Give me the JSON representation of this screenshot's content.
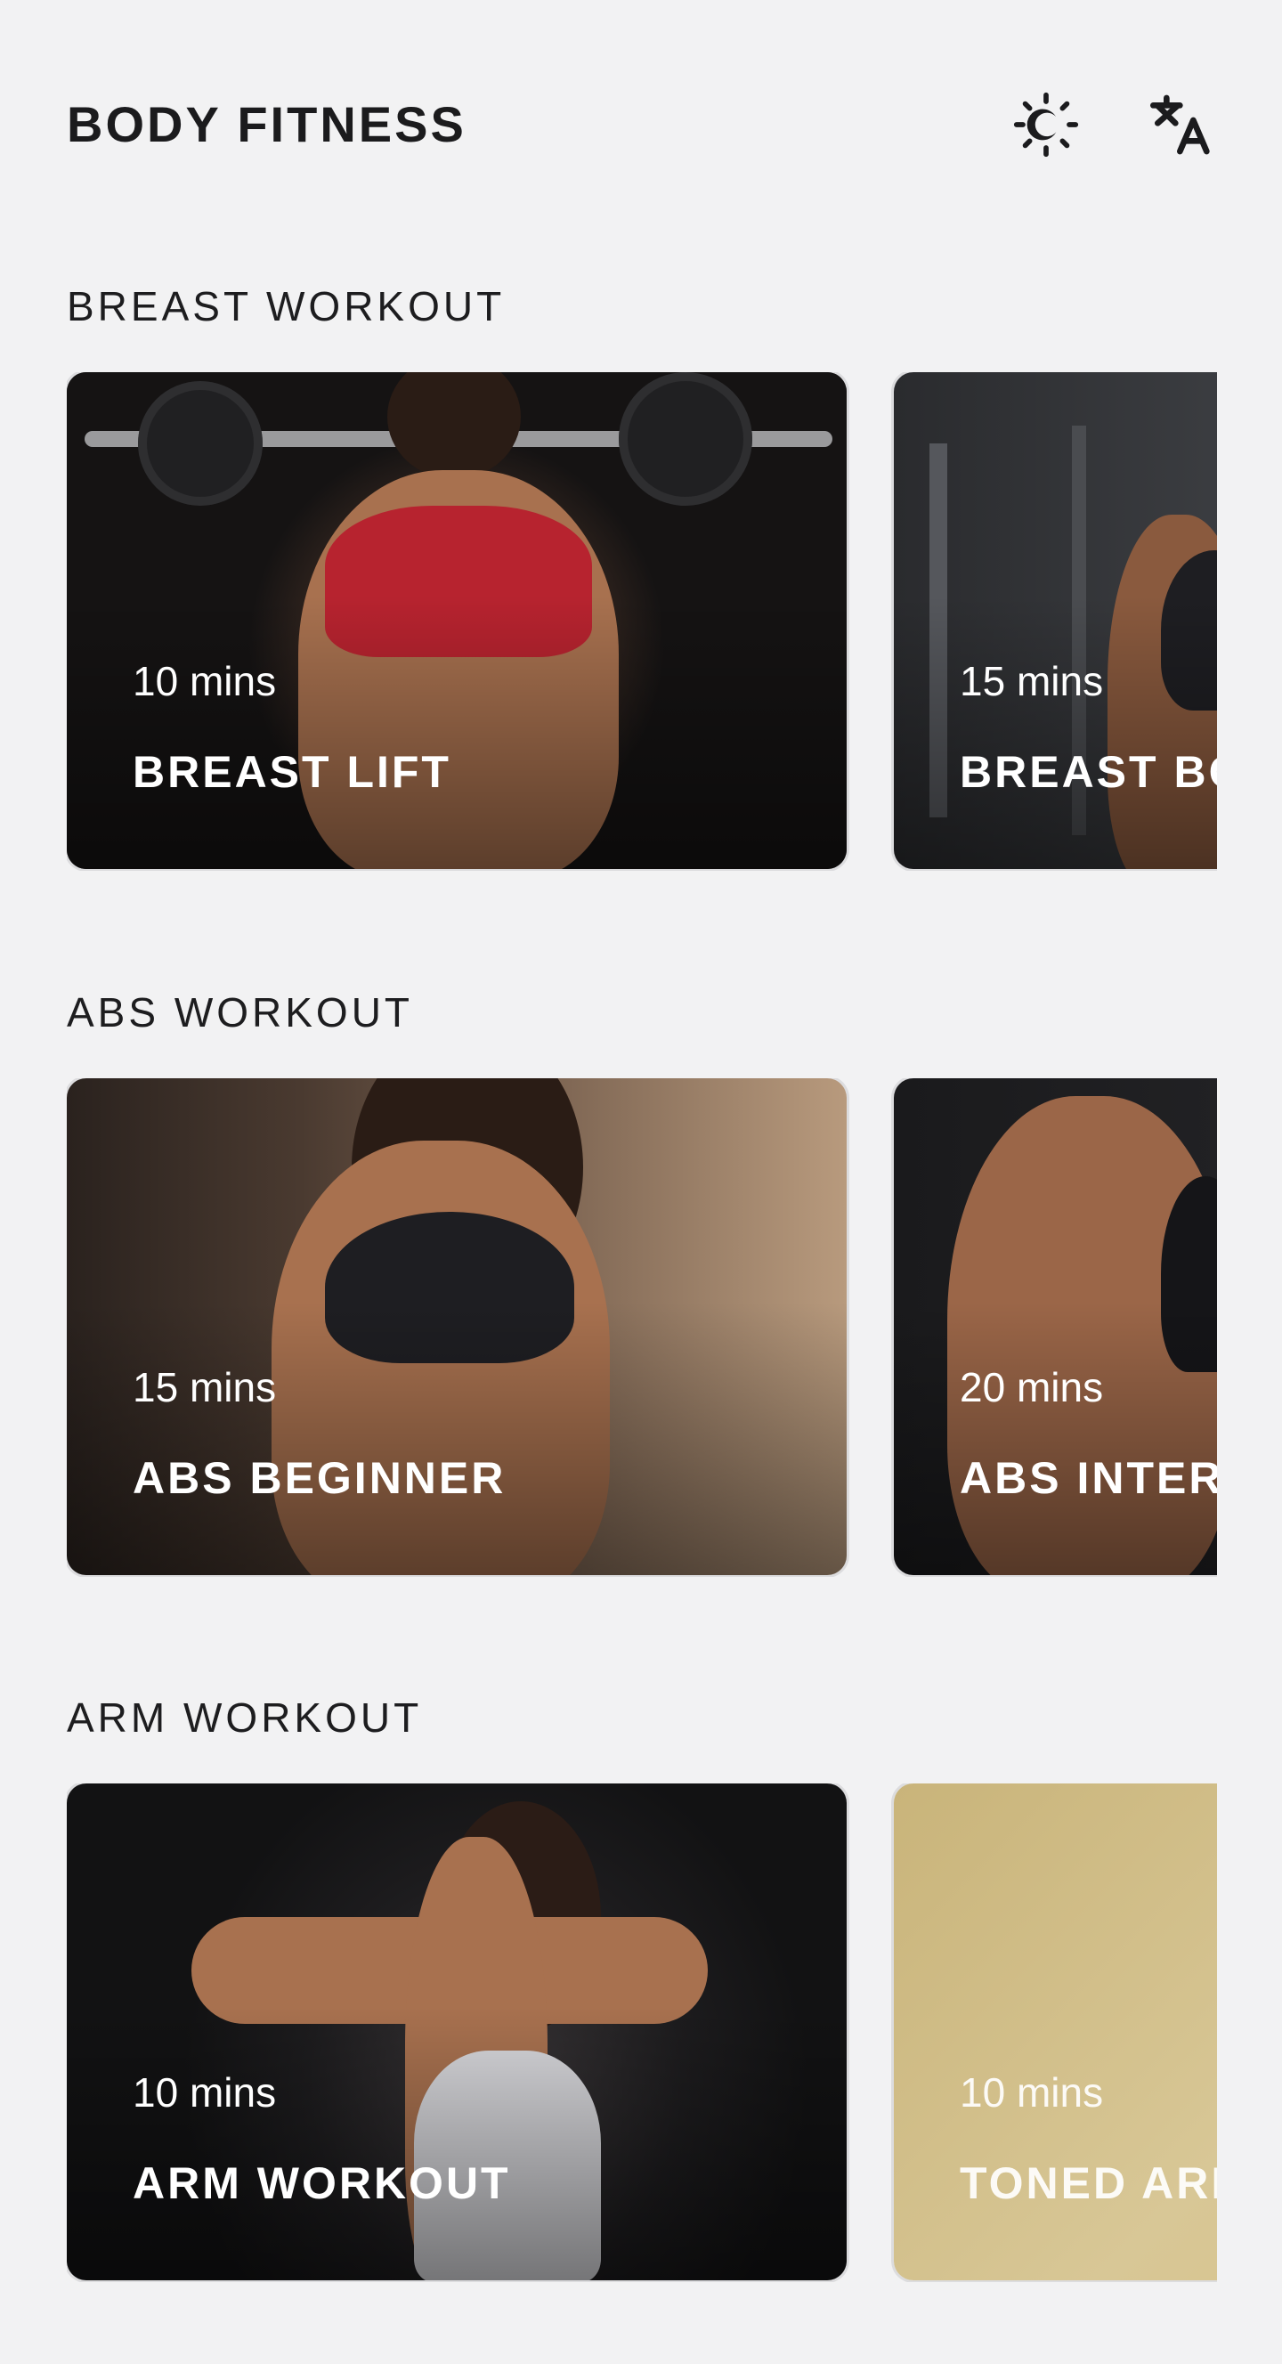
{
  "header": {
    "title": "BODY FITNESS",
    "theme_icon": "theme-toggle-icon",
    "language_icon": "translate-icon"
  },
  "sections": [
    {
      "title": "BREAST WORKOUT",
      "cards": [
        {
          "duration": "10 mins",
          "name": "BREAST LIFT"
        },
        {
          "duration": "15 mins",
          "name": "BREAST BO"
        }
      ]
    },
    {
      "title": "ABS WORKOUT",
      "cards": [
        {
          "duration": "15 mins",
          "name": "ABS BEGINNER"
        },
        {
          "duration": "20 mins",
          "name": "ABS INTER"
        }
      ]
    },
    {
      "title": "ARM WORKOUT",
      "cards": [
        {
          "duration": "10 mins",
          "name": "ARM WORKOUT"
        },
        {
          "duration": "10 mins",
          "name": "TONED ARI"
        }
      ]
    }
  ],
  "colors": {
    "background": "#f2f2f3",
    "text": "#1b1b1d",
    "card_text": "#ffffff"
  }
}
